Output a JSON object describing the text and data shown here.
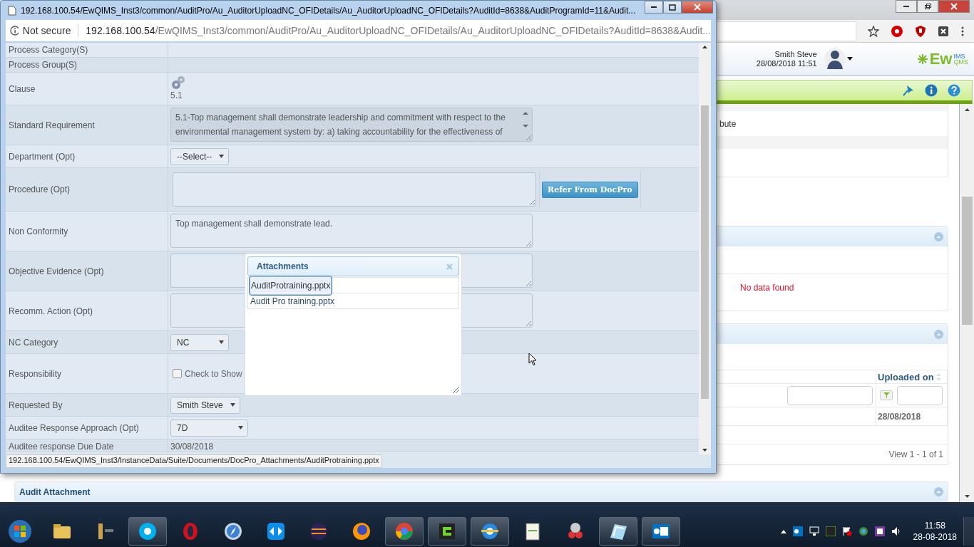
{
  "popup": {
    "title": "192.168.100.54/EwQIMS_Inst3/common/AuditPro/Au_AuditorUploadNC_OFIDetails/Au_AuditorUploadNC_OFIDetails?AuditId=8638&AuditProgramId=11&Audit...",
    "security": "Not secure",
    "url_host": "192.168.100.54",
    "url_path": "/EwQIMS_Inst3/common/AuditPro/Au_AuditorUploadNC_OFIDetails/Au_AuditorUploadNC_OFIDetails?AuditId=8638&Audit...",
    "fields": [
      {
        "label": "Process Category(S)",
        "kind": "empty"
      },
      {
        "label": "Process Group(S)",
        "kind": "empty"
      },
      {
        "label": "Clause",
        "kind": "clause",
        "value": "5.1"
      },
      {
        "label": "Standard Requirement",
        "kind": "textarea",
        "disabled": true,
        "value": "5.1-Top management shall demonstrate leadership and commitment with respect to the environmental management system by: a) taking accountability for the effectiveness of"
      },
      {
        "label": "Department (Opt)",
        "kind": "select",
        "value": "--Select--"
      },
      {
        "label": "Procedure (Opt)",
        "kind": "textarea_button",
        "button": "Refer From DocPro"
      },
      {
        "label": "Non Conformity",
        "kind": "textarea",
        "disabled": false,
        "value": "Top management shall demonstrate lead."
      },
      {
        "label": "Objective Evidence (Opt)",
        "kind": "textarea",
        "disabled": false
      },
      {
        "label": "Recomm. Action (Opt)",
        "kind": "textarea",
        "disabled": false
      },
      {
        "label": "NC Category",
        "kind": "select",
        "value": "NC"
      },
      {
        "label": "Responsibility",
        "kind": "checkbox",
        "checked": false,
        "value": "Check to Show"
      },
      {
        "label": "Requested By",
        "kind": "select",
        "value": "Smith Steve"
      },
      {
        "label": "Auditee Response Approach (Opt)",
        "kind": "select",
        "value": "7D"
      },
      {
        "label": "Auditee response Due Date",
        "kind": "text",
        "value": "30/08/2018"
      }
    ],
    "status_url": "192.168.100.54/EwQIMS_Inst3/InstanceData/Suite/Documents/DocPro_Attachments/AuditProtraining.pptx",
    "attachments": {
      "title": "Attachments",
      "items": [
        {
          "name": "AuditProtraining.pptx",
          "selected": true
        },
        {
          "name": "Audit Pro training.pptx",
          "selected": false
        }
      ]
    }
  },
  "background": {
    "user": "Smith Steve",
    "datetime": "28/08/2018 11:51",
    "logo": {
      "main": "Ew",
      "top": "IMS",
      "bottom": "QMS"
    },
    "fragment": "bute",
    "no_data": "No data found",
    "column": "Uploaded on",
    "cell": "28/08/2018",
    "pager": "View 1 - 1 of 1",
    "panel_title": "Audit Attachment"
  },
  "taskbar": {
    "apps": [
      {
        "kind": "folder",
        "running": false
      },
      {
        "kind": "tools",
        "running": false
      },
      {
        "kind": "chat",
        "running": true
      },
      {
        "kind": "ring",
        "running": false
      },
      {
        "kind": "compass",
        "running": false
      },
      {
        "kind": "arrows",
        "running": false
      },
      {
        "kind": "sphere",
        "running": false
      },
      {
        "kind": "fox",
        "running": false
      },
      {
        "kind": "browser",
        "running": true
      },
      {
        "kind": "square",
        "running": true
      },
      {
        "kind": "globe",
        "running": true
      },
      {
        "kind": "pad",
        "running": false
      },
      {
        "kind": "scissors",
        "running": false
      },
      {
        "kind": "notes",
        "running": true
      },
      {
        "kind": "mail",
        "running": true
      }
    ],
    "time": "11:58",
    "date": "28-08-2018"
  }
}
